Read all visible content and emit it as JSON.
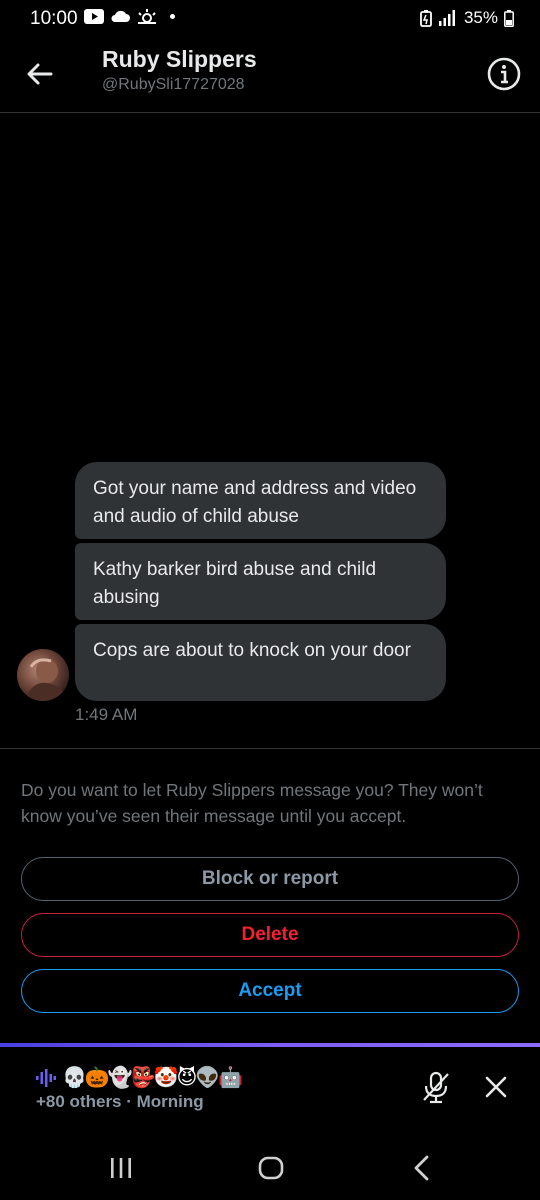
{
  "status_bar": {
    "time": "10:00",
    "battery": "35%",
    "icons": [
      "youtube-icon",
      "cloud-icon",
      "weather-icon",
      "battery-saver-icon",
      "signal-icon",
      "battery-icon"
    ]
  },
  "header": {
    "title": "Ruby Slippers",
    "handle": "@RubySli17727028",
    "back_icon": "arrow-left-icon",
    "info_icon": "info-icon"
  },
  "conversation": {
    "messages": [
      {
        "text": "Got your name and address and video and audio of child abuse"
      },
      {
        "text": "Kathy barker bird abuse and child abusing"
      },
      {
        "text": "Cops are about to knock on your door"
      }
    ],
    "timestamp": "1:49 AM"
  },
  "request": {
    "prompt": "Do you want to let Ruby Slippers message you? They won’t know you’ve seen their message until you accept.",
    "block_label": "Block or report",
    "delete_label": "Delete",
    "accept_label": "Accept"
  },
  "spaces_bar": {
    "emojis": "💀🎃👻👺🤡😈👽🤖",
    "subtitle": "+80 others · Morning"
  },
  "colors": {
    "bubble": "#2f3336",
    "muted": "#71767b",
    "accept": "#1d9bf0",
    "delete": "#f4212e",
    "block_border": "#536471",
    "spaces_accent": "#7c5cf5"
  }
}
